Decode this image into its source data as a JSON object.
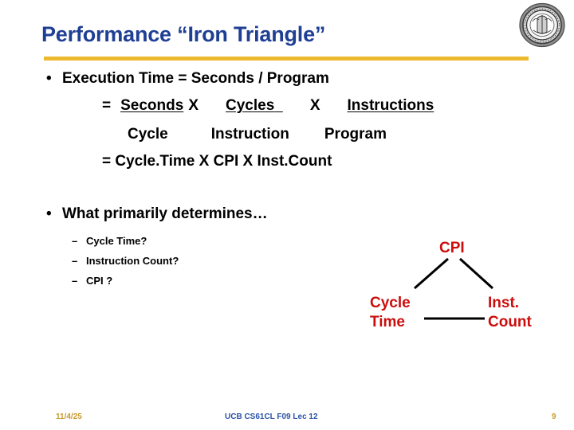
{
  "slide": {
    "title": "Performance “Iron Triangle”",
    "accent_gold": "#EDB92E",
    "title_blue": "#1F3F94",
    "diagram_red": "#CC0D0D"
  },
  "logo": {
    "name": "uc-berkeley-seal"
  },
  "content": {
    "bullet_1": {
      "marker": "•",
      "text": "Execution Time = Seconds / Program"
    },
    "formula": {
      "line_1": {
        "equals": "=",
        "numerator_1": "Seconds",
        "times_1": "X",
        "numerator_2": "Cycles",
        "times_2": "X",
        "numerator_3": "Instructions"
      },
      "line_2": {
        "denominator_1": "Cycle",
        "denominator_2": "Instruction",
        "denominator_3": "Program"
      },
      "line_3": {
        "text": "= Cycle.Time X  CPI X  Inst.Count"
      }
    },
    "bullet_2": {
      "marker": "•",
      "text": "What primarily determines…"
    },
    "sub_bullets": [
      {
        "marker": "–",
        "text": "Cycle Time?"
      },
      {
        "marker": "–",
        "text": "Instruction Count?"
      },
      {
        "marker": "–",
        "text": "CPI ?"
      }
    ]
  },
  "diagram": {
    "apex": "CPI",
    "left_line_1": "Cycle",
    "left_line_2": "Time",
    "right_line_1": "Inst.",
    "right_line_2": "Count"
  },
  "footer": {
    "date": "11/4/25",
    "center": "UCB CS61CL F09 Lec 12",
    "page": "9"
  }
}
